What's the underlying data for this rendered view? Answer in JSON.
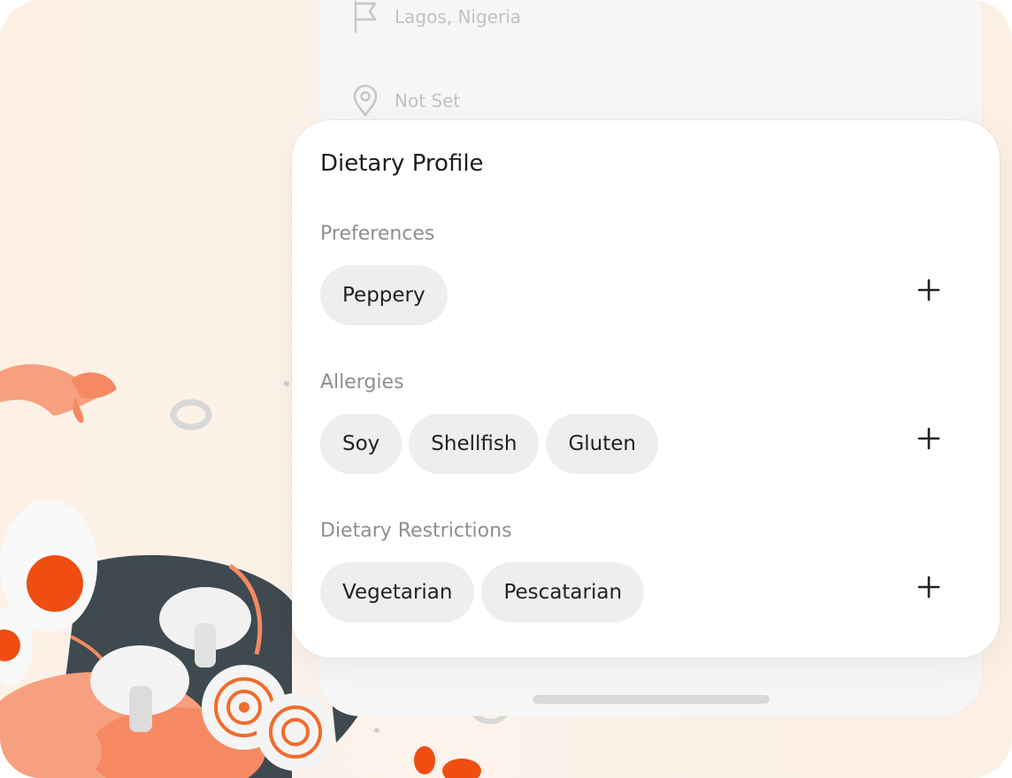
{
  "background_screen": {
    "location_text": "Lagos, Nigeria",
    "address_text": "Not Set"
  },
  "dietary_profile": {
    "title": "Dietary Profile",
    "sections": [
      {
        "label": "Preferences",
        "tags": [
          "Peppery"
        ]
      },
      {
        "label": "Allergies",
        "tags": [
          "Soy",
          "Shellfish",
          "Gluten"
        ]
      },
      {
        "label": "Dietary Restrictions",
        "tags": [
          "Vegetarian",
          "Pescatarian"
        ]
      }
    ]
  },
  "icons": {
    "flag": "flag-icon",
    "pin": "map-pin-icon",
    "add": "plus-icon"
  },
  "colors": {
    "accent_orange": "#f26b2b",
    "shrimp": "#f58a62",
    "chip_bg": "#eeeeee",
    "label_gray": "#8f8f8f"
  }
}
